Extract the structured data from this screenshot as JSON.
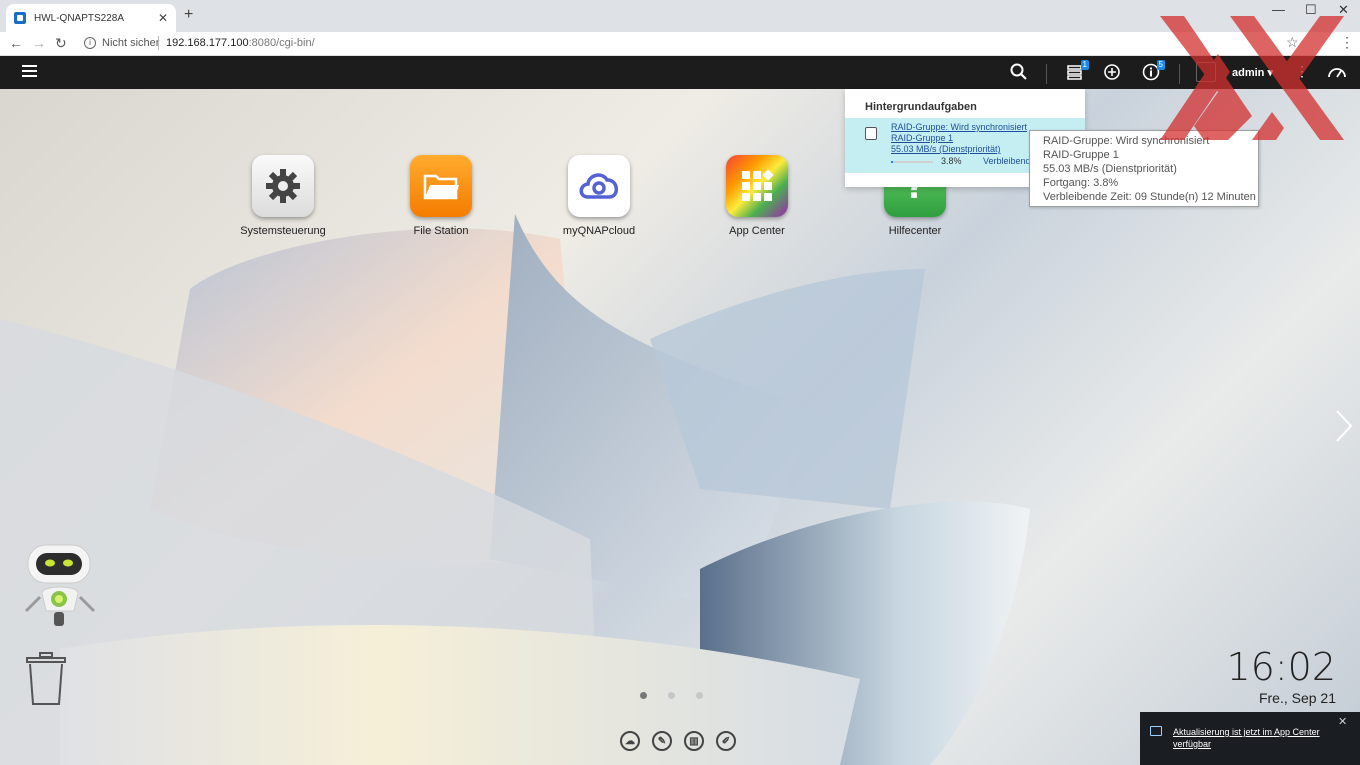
{
  "browser": {
    "tab_title": "HWL-QNAPTS228A",
    "tab_close": "✕",
    "new_tab": "+",
    "insecure_label": "Nicht sicher",
    "url_host": "192.168.177.100",
    "url_path": ":8080/cgi-bin/"
  },
  "topbar": {
    "user": "admin ▾",
    "background_tasks_badge": "1",
    "notifications_badge": "5"
  },
  "apps": [
    {
      "label": "Systemsteuerung",
      "icon": "gear-icon"
    },
    {
      "label": "File Station",
      "icon": "folder-icon"
    },
    {
      "label": "myQNAPcloud",
      "icon": "cloud-icon"
    },
    {
      "label": "App Center",
      "icon": "grid-icon"
    },
    {
      "label": "Hilfecenter",
      "icon": "help-icon"
    }
  ],
  "background_tasks": {
    "title": "Hintergrundaufgaben",
    "task": {
      "line1": "RAID-Gruppe: Wird synchronisiert",
      "line2": "RAID-Gruppe 1",
      "line3": "55.03 MB/s (Dienstpriorität)",
      "percent": "3.8%",
      "progress": 0.038,
      "remaining_label": "Verbleibende"
    }
  },
  "tooltip": {
    "line1": "RAID-Gruppe: Wird synchronisiert",
    "line2": "RAID-Gruppe 1",
    "line3": "55.03 MB/s (Dienstpriorität)",
    "line4": "Fortgang: 3.8%",
    "line5": "Verbleibende Zeit: 09 Stunde(n) 12 Minuten"
  },
  "clock": {
    "time": "16:02",
    "date": "Fre., Sep 21"
  },
  "notification": {
    "text": "Aktualisierung ist jetzt im App Center verfügbar",
    "close": "✕"
  },
  "colors": {
    "topbar": "#1c1c1c",
    "accent": "#1e88e5",
    "task_highlight": "#c5eef3"
  }
}
